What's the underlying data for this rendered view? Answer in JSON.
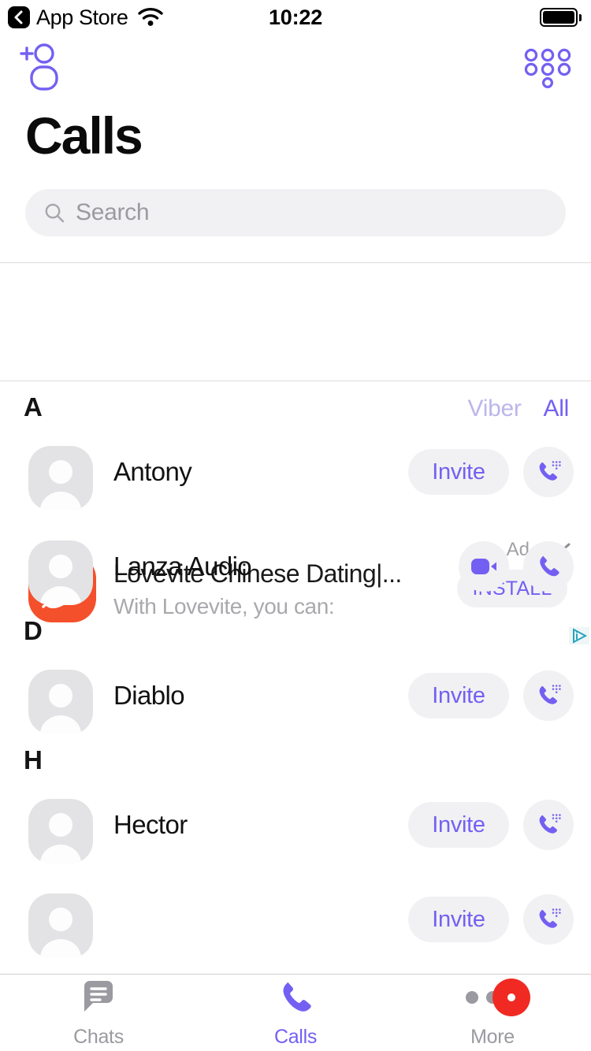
{
  "status_bar": {
    "back_label": "App Store",
    "back_icon": "chevron-left-icon",
    "wifi_icon": "wifi-icon",
    "time": "10:22",
    "battery_icon": "battery-full-icon"
  },
  "nav": {
    "add_contact_icon": "add-contact-icon",
    "dialpad_icon": "dialpad-icon"
  },
  "header": {
    "title": "Calls"
  },
  "search": {
    "placeholder": "Search",
    "value": "",
    "icon": "search-icon"
  },
  "ad": {
    "label": "Ad",
    "chevron_icon": "chevron-down-icon",
    "logo_icon": "lovevite-leaf-logo",
    "title": "Lovevite Chinese Dating|...",
    "subtitle": "With Lovevite, you can:",
    "install_label": "INSTALL",
    "adchoices_icon": "adchoices-icon"
  },
  "filter": {
    "options": [
      "Viber",
      "All"
    ],
    "selected": "All",
    "inactive_color": "#bcb6ec",
    "active_color": "#7360f2"
  },
  "colors": {
    "accent": "#7360f2",
    "badge_red": "#f02a22",
    "ad_logo": "#f4502b",
    "pill_bg": "#f1f1f3",
    "muted_text": "#9a9aa0"
  },
  "sections": [
    {
      "letter": "A",
      "show_filter": true,
      "contacts": [
        {
          "name": "Antony",
          "avatar_icon": "avatar-placeholder-icon",
          "invite_label": "Invite",
          "has_invite": true,
          "has_video": false,
          "call_icon": "phone-viberout-icon"
        },
        {
          "name": "Lanza Audio",
          "avatar_icon": "avatar-placeholder-icon",
          "invite_label": "",
          "has_invite": false,
          "has_video": true,
          "video_icon": "video-camera-icon",
          "call_icon": "phone-icon"
        }
      ]
    },
    {
      "letter": "D",
      "show_filter": false,
      "contacts": [
        {
          "name": "Diablo",
          "avatar_icon": "avatar-placeholder-icon",
          "invite_label": "Invite",
          "has_invite": true,
          "has_video": false,
          "call_icon": "phone-viberout-icon"
        }
      ]
    },
    {
      "letter": "H",
      "show_filter": false,
      "contacts": [
        {
          "name": "Hector",
          "avatar_icon": "avatar-placeholder-icon",
          "invite_label": "Invite",
          "has_invite": true,
          "has_video": false,
          "call_icon": "phone-viberout-icon"
        },
        {
          "name": "",
          "avatar_icon": "avatar-placeholder-icon",
          "invite_label": "Invite",
          "has_invite": true,
          "has_video": false,
          "call_icon": "phone-viberout-icon"
        }
      ]
    }
  ],
  "tabbar": {
    "tabs": [
      {
        "label": "Chats",
        "icon": "chat-bubble-icon",
        "active": false,
        "badge": false
      },
      {
        "label": "Calls",
        "icon": "phone-icon",
        "active": true,
        "badge": false
      },
      {
        "label": "More",
        "icon": "more-dots-icon",
        "active": false,
        "badge": true
      }
    ]
  }
}
